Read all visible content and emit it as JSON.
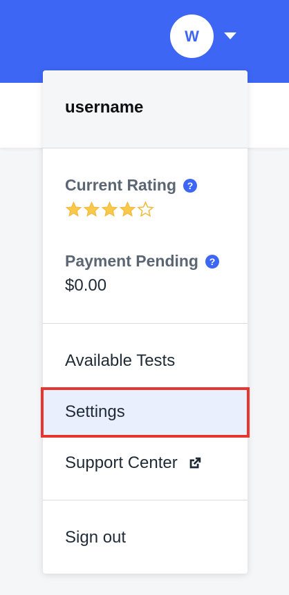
{
  "header": {
    "avatar_initial": "W"
  },
  "menu": {
    "username": "username",
    "rating": {
      "label": "Current Rating",
      "value": 4,
      "max": 5
    },
    "payment": {
      "label": "Payment Pending",
      "value": "$0.00"
    },
    "items": [
      {
        "label": "Available Tests"
      },
      {
        "label": "Settings",
        "active": true
      },
      {
        "label": "Support Center",
        "icon": "external-link-icon"
      }
    ],
    "signout_label": "Sign out"
  },
  "colors": {
    "brand": "#3d66f4",
    "star": "#f8c94c",
    "highlight": "#e8352f",
    "active_bg": "#e9effd"
  }
}
